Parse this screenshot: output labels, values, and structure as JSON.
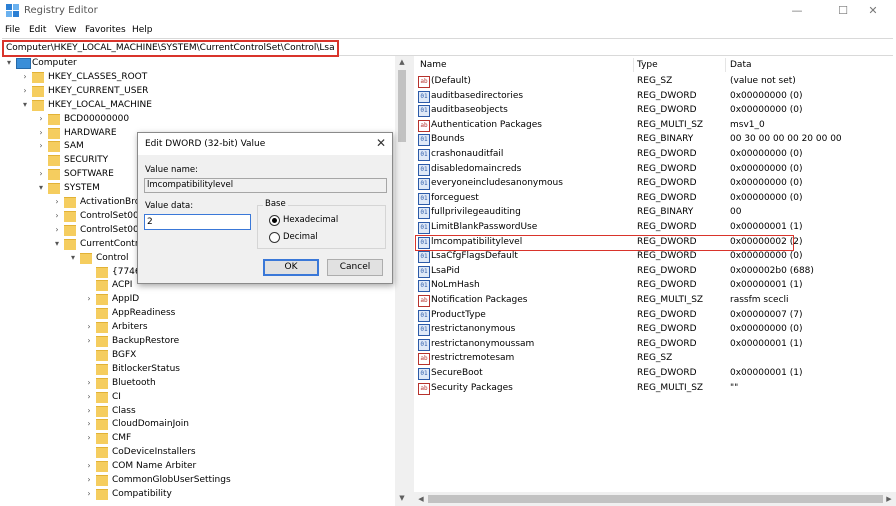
{
  "window": {
    "title": "Registry Editor",
    "minimize": "—",
    "maximize": "☐",
    "close": "✕"
  },
  "menu": [
    "File",
    "Edit",
    "View",
    "Favorites",
    "Help"
  ],
  "address": "Computer\\HKEY_LOCAL_MACHINE\\SYSTEM\\CurrentControlSet\\Control\\Lsa",
  "tree": [
    {
      "label": "Computer",
      "arrow": "▾"
    },
    {
      "label": "HKEY_CLASSES_ROOT",
      "arrow": "›"
    },
    {
      "label": "HKEY_CURRENT_USER",
      "arrow": "›"
    },
    {
      "label": "HKEY_LOCAL_MACHINE",
      "arrow": "▾"
    },
    {
      "label": "BCD00000000",
      "arrow": "›"
    },
    {
      "label": "HARDWARE",
      "arrow": "›"
    },
    {
      "label": "SAM",
      "arrow": "›"
    },
    {
      "label": "SECURITY",
      "arrow": ""
    },
    {
      "label": "SOFTWARE",
      "arrow": "›"
    },
    {
      "label": "SYSTEM",
      "arrow": "▾"
    },
    {
      "label": "ActivationBroker",
      "arrow": "›"
    },
    {
      "label": "ControlSet001",
      "arrow": "›"
    },
    {
      "label": "ControlSet002",
      "arrow": "›"
    },
    {
      "label": "CurrentControlSet",
      "arrow": "▾"
    },
    {
      "label": "Control",
      "arrow": "▾"
    },
    {
      "label": "{7746D80F-",
      "arrow": ""
    },
    {
      "label": "ACPI",
      "arrow": ""
    },
    {
      "label": "AppID",
      "arrow": "›"
    },
    {
      "label": "AppReadiness",
      "arrow": ""
    },
    {
      "label": "Arbiters",
      "arrow": "›"
    },
    {
      "label": "BackupRestore",
      "arrow": "›"
    },
    {
      "label": "BGFX",
      "arrow": ""
    },
    {
      "label": "BitlockerStatus",
      "arrow": ""
    },
    {
      "label": "Bluetooth",
      "arrow": "›"
    },
    {
      "label": "CI",
      "arrow": "›"
    },
    {
      "label": "Class",
      "arrow": "›"
    },
    {
      "label": "CloudDomainJoin",
      "arrow": "›"
    },
    {
      "label": "CMF",
      "arrow": "›"
    },
    {
      "label": "CoDeviceInstallers",
      "arrow": ""
    },
    {
      "label": "COM Name Arbiter",
      "arrow": "›"
    },
    {
      "label": "CommonGlobUserSettings",
      "arrow": "›"
    },
    {
      "label": "Compatibility",
      "arrow": "›"
    }
  ],
  "columns": {
    "name": "Name",
    "type": "Type",
    "data": "Data"
  },
  "values": [
    {
      "icon": "ab",
      "name": "(Default)",
      "type": "REG_SZ",
      "data": "(value not set)"
    },
    {
      "icon": "01",
      "name": "auditbasedirectories",
      "type": "REG_DWORD",
      "data": "0x00000000 (0)"
    },
    {
      "icon": "01",
      "name": "auditbaseobjects",
      "type": "REG_DWORD",
      "data": "0x00000000 (0)"
    },
    {
      "icon": "ab",
      "name": "Authentication Packages",
      "type": "REG_MULTI_SZ",
      "data": "msv1_0"
    },
    {
      "icon": "01",
      "name": "Bounds",
      "type": "REG_BINARY",
      "data": "00 30 00 00 00 20 00 00"
    },
    {
      "icon": "01",
      "name": "crashonauditfail",
      "type": "REG_DWORD",
      "data": "0x00000000 (0)"
    },
    {
      "icon": "01",
      "name": "disabledomaincreds",
      "type": "REG_DWORD",
      "data": "0x00000000 (0)"
    },
    {
      "icon": "01",
      "name": "everyoneincludesanonymous",
      "type": "REG_DWORD",
      "data": "0x00000000 (0)"
    },
    {
      "icon": "01",
      "name": "forceguest",
      "type": "REG_DWORD",
      "data": "0x00000000 (0)"
    },
    {
      "icon": "01",
      "name": "fullprivilegeauditing",
      "type": "REG_BINARY",
      "data": "00"
    },
    {
      "icon": "01",
      "name": "LimitBlankPasswordUse",
      "type": "REG_DWORD",
      "data": "0x00000001 (1)"
    },
    {
      "icon": "01",
      "name": "lmcompatibilitylevel",
      "type": "REG_DWORD",
      "data": "0x00000002 (2)"
    },
    {
      "icon": "01",
      "name": "LsaCfgFlagsDefault",
      "type": "REG_DWORD",
      "data": "0x00000000 (0)"
    },
    {
      "icon": "01",
      "name": "LsaPid",
      "type": "REG_DWORD",
      "data": "0x000002b0 (688)"
    },
    {
      "icon": "01",
      "name": "NoLmHash",
      "type": "REG_DWORD",
      "data": "0x00000001 (1)"
    },
    {
      "icon": "ab",
      "name": "Notification Packages",
      "type": "REG_MULTI_SZ",
      "data": "rassfm scecli"
    },
    {
      "icon": "01",
      "name": "ProductType",
      "type": "REG_DWORD",
      "data": "0x00000007 (7)"
    },
    {
      "icon": "01",
      "name": "restrictanonymous",
      "type": "REG_DWORD",
      "data": "0x00000000 (0)"
    },
    {
      "icon": "01",
      "name": "restrictanonymoussam",
      "type": "REG_DWORD",
      "data": "0x00000001 (1)"
    },
    {
      "icon": "ab",
      "name": "restrictremotesam",
      "type": "REG_SZ",
      "data": ""
    },
    {
      "icon": "01",
      "name": "SecureBoot",
      "type": "REG_DWORD",
      "data": "0x00000001 (1)"
    },
    {
      "icon": "ab",
      "name": "Security Packages",
      "type": "REG_MULTI_SZ",
      "data": "\"\""
    }
  ],
  "dialog": {
    "title": "Edit DWORD (32-bit) Value",
    "close": "✕",
    "value_name_label": "Value name:",
    "value_name": "lmcompatibilitylevel",
    "value_data_label": "Value data:",
    "value_data": "2",
    "base_label": "Base",
    "hex_label": "Hexadecimal",
    "dec_label": "Decimal",
    "selected_base": "Hexadecimal",
    "ok": "OK",
    "cancel": "Cancel"
  }
}
